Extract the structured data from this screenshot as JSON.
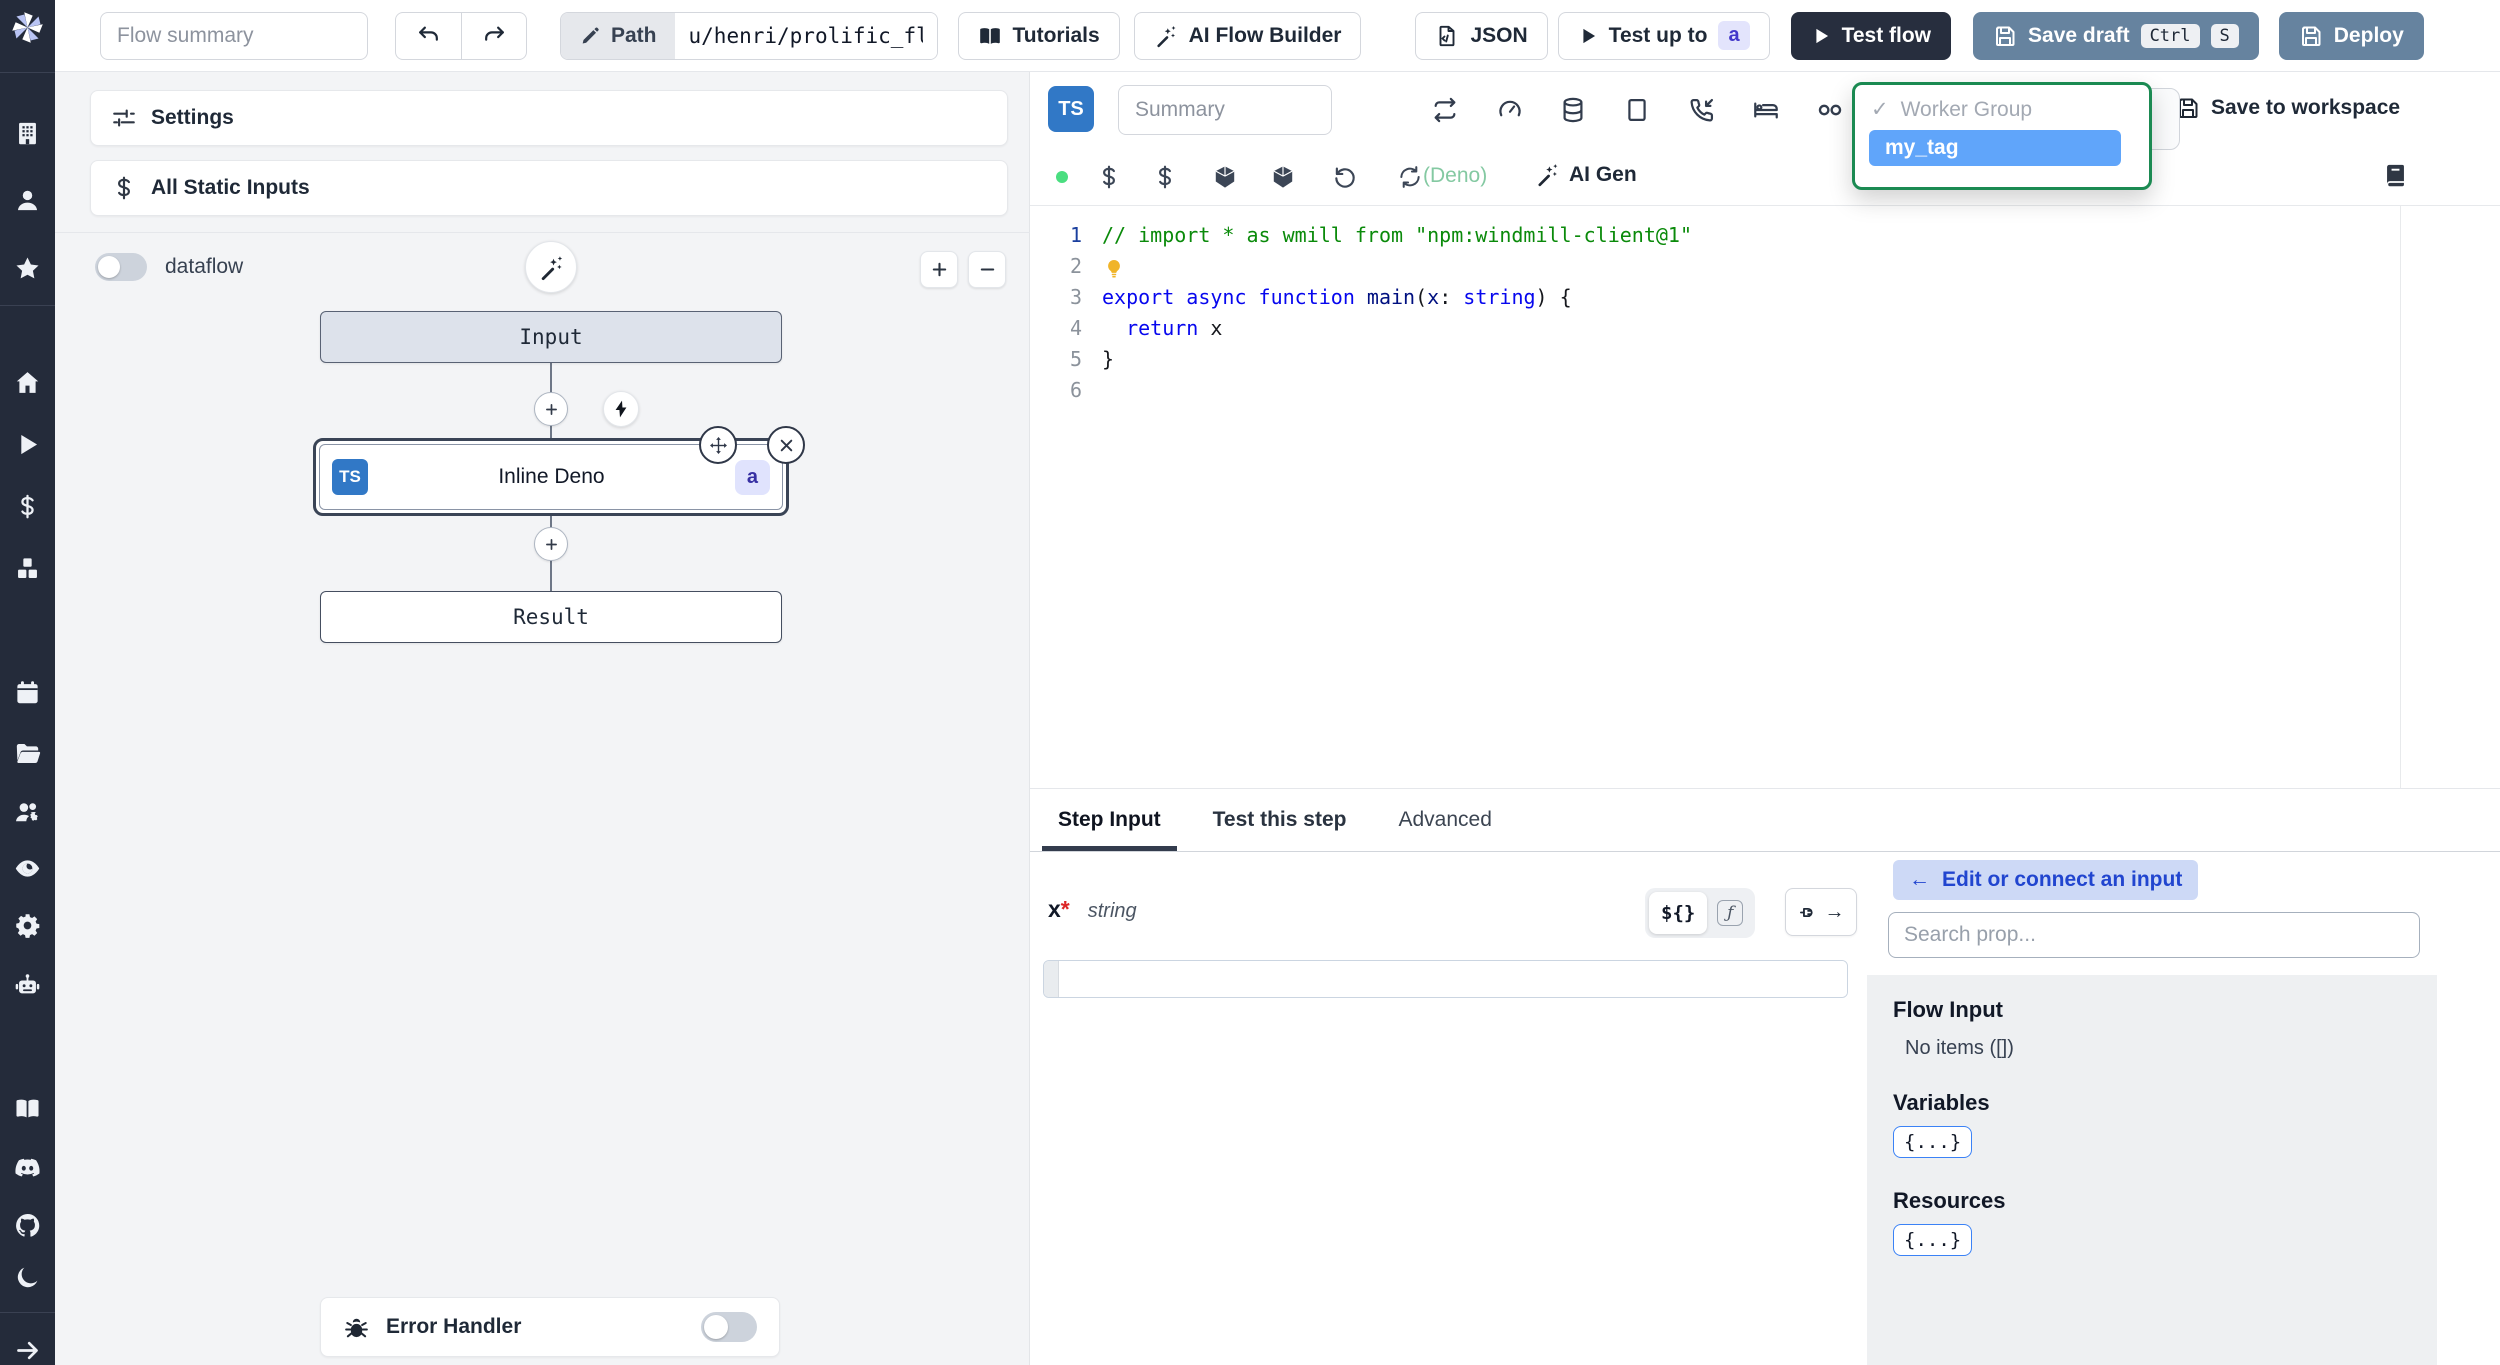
{
  "topbar": {
    "flow_summary_placeholder": "Flow summary",
    "path_label": "Path",
    "path_value": "u/henri/prolific_flow",
    "tutorials_label": "Tutorials",
    "ai_flow_builder_label": "AI Flow Builder",
    "json_label": "JSON",
    "test_up_to_label": "Test up to",
    "test_up_to_badge": "a",
    "test_flow_label": "Test flow",
    "save_draft_label": "Save draft",
    "save_draft_kbd": [
      "Ctrl",
      "S"
    ],
    "deploy_label": "Deploy"
  },
  "sidebar": {
    "icons": [
      "building",
      "user",
      "star",
      "home",
      "play",
      "dollar",
      "cubes",
      "calendar",
      "folder",
      "users-gear",
      "eye",
      "gear",
      "robot",
      "book-open",
      "discord",
      "github",
      "moon",
      "arrow-right"
    ]
  },
  "flow_panel": {
    "settings_label": "Settings",
    "all_static_inputs_label": "All Static Inputs",
    "dataflow_label": "dataflow",
    "input_node_label": "Input",
    "step_node": {
      "lang_badge": "TS",
      "label": "Inline Deno",
      "id_badge": "a"
    },
    "result_node_label": "Result",
    "error_handler_label": "Error Handler"
  },
  "editor": {
    "lang_badge": "TS",
    "summary_placeholder": "Summary",
    "step_setting_icons": [
      "repeat",
      "gauge",
      "database",
      "square",
      "phone-incoming",
      "bed",
      "voicemail"
    ],
    "meta_icons": [
      "status-dot",
      "dollar",
      "dollar",
      "cube",
      "cube",
      "rotate-left",
      "refresh"
    ],
    "runtime_label": "(Deno)",
    "ai_gen_label": "AI Gen",
    "worker_group_dropdown": {
      "check": "✓",
      "group_label": "Worker Group",
      "selected_tag": "my_tag"
    },
    "save_to_workspace_label": "Save to workspace",
    "code": {
      "language": "typescript",
      "lines": [
        {
          "num": "1",
          "tokens": [
            {
              "t": "// import * as wmill from \"npm:windmill-client@1\"",
              "c": "comment"
            }
          ]
        },
        {
          "num": "2",
          "tokens": [
            {
              "icon": "lightbulb"
            }
          ]
        },
        {
          "num": "3",
          "tokens": [
            {
              "t": "export ",
              "c": "kw"
            },
            {
              "t": "async ",
              "c": "kw"
            },
            {
              "t": "function ",
              "c": "kw"
            },
            {
              "t": "main",
              "c": "ident"
            },
            {
              "t": "(",
              "c": "pl"
            },
            {
              "t": "x",
              "c": "ident"
            },
            {
              "t": ": ",
              "c": "pl"
            },
            {
              "t": "string",
              "c": "kw"
            },
            {
              "t": ") {",
              "c": "pl"
            }
          ]
        },
        {
          "num": "4",
          "tokens": [
            {
              "t": "  ",
              "c": "pl"
            },
            {
              "t": "return",
              "c": "kw"
            },
            {
              "t": " x",
              "c": "pl"
            }
          ]
        },
        {
          "num": "5",
          "tokens": [
            {
              "t": "}",
              "c": "pl"
            }
          ]
        },
        {
          "num": "6",
          "tokens": []
        }
      ]
    }
  },
  "bottom_panel": {
    "tabs": [
      {
        "label": "Step Input",
        "active": true
      },
      {
        "label": "Test this step",
        "active": false
      },
      {
        "label": "Advanced",
        "active": false
      }
    ],
    "field": {
      "name": "x",
      "required_marker": "*",
      "type": "string",
      "value": ""
    },
    "editor_toggle": {
      "expr_label": "${}",
      "fn_label": "ƒ"
    },
    "plug_arrow": "→",
    "connect_panel": {
      "back_arrow": "←",
      "edit_connect_label": "Edit or connect an input",
      "search_placeholder": "Search prop...",
      "sections": [
        {
          "title": "Flow Input",
          "empty_text": "No items ([])"
        },
        {
          "title": "Variables",
          "chip": "{...}"
        },
        {
          "title": "Resources",
          "chip": "{...}"
        }
      ]
    }
  },
  "colors": {
    "sidebar_dark": "#242b3a",
    "steel_blue_button": "#66839f",
    "dark_button": "#272e3e",
    "ts_badge_blue": "#3178c6",
    "selected_tag_bg": "#60a5fa",
    "dropdown_border_green": "#1b8a52",
    "runtime_green": "#84c9a2",
    "status_dot_green": "#4ade80",
    "badge_indigo_bg": "#e0e3fd",
    "badge_indigo_text": "#3730a3",
    "required_red": "#dc2626",
    "chip_border_blue": "#3b82f6"
  }
}
